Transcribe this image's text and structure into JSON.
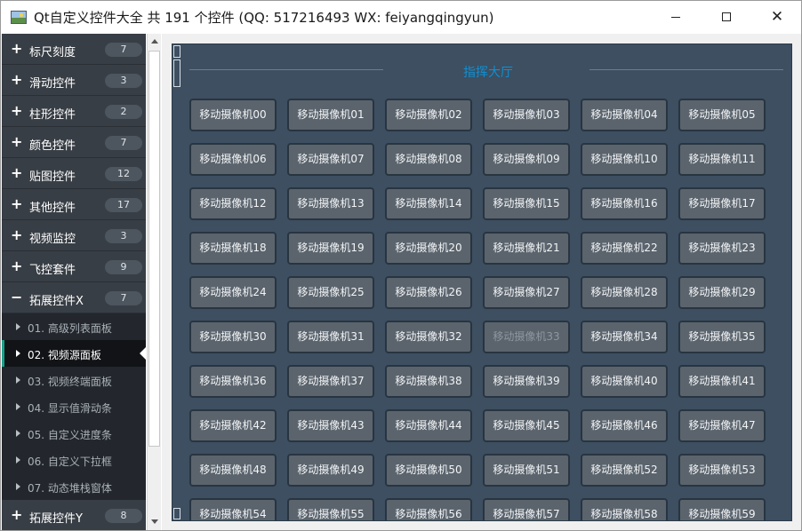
{
  "window": {
    "title": "Qt自定义控件大全 共 191 个控件 (QQ: 517216493 WX: feiyangqingyun)",
    "icon": "app-picture-icon",
    "controls": {
      "minimize": "─",
      "maximize": "☐",
      "close": "✕"
    }
  },
  "sidebar": {
    "parents": [
      {
        "name": "ruler",
        "label": "标尺刻度",
        "count": "7",
        "expanded": false
      },
      {
        "name": "slider",
        "label": "滑动控件",
        "count": "3",
        "expanded": false
      },
      {
        "name": "bar",
        "label": "柱形控件",
        "count": "2",
        "expanded": false
      },
      {
        "name": "color",
        "label": "颜色控件",
        "count": "7",
        "expanded": false
      },
      {
        "name": "image",
        "label": "贴图控件",
        "count": "12",
        "expanded": false
      },
      {
        "name": "other",
        "label": "其他控件",
        "count": "17",
        "expanded": false
      },
      {
        "name": "video",
        "label": "视频监控",
        "count": "3",
        "expanded": false
      },
      {
        "name": "flight",
        "label": "飞控套件",
        "count": "9",
        "expanded": false
      },
      {
        "name": "extx",
        "label": "拓展控件X",
        "count": "7",
        "expanded": true
      },
      {
        "name": "exty",
        "label": "拓展控件Y",
        "count": "8",
        "expanded": false
      }
    ],
    "children": [
      {
        "label": "01. 高级列表面板",
        "active": false
      },
      {
        "label": "02. 视频源面板",
        "active": true
      },
      {
        "label": "03. 视频终端面板",
        "active": false
      },
      {
        "label": "04. 显示值滑动条",
        "active": false
      },
      {
        "label": "05. 自定义进度条",
        "active": false
      },
      {
        "label": "06. 自定义下拉框",
        "active": false
      },
      {
        "label": "07. 动态堆栈窗体",
        "active": false
      }
    ],
    "expand_symbol": "+",
    "collapse_symbol": "−"
  },
  "panel": {
    "group_title": "指挥大厅",
    "disabled_index": 33,
    "cameras": [
      "移动摄像机00",
      "移动摄像机01",
      "移动摄像机02",
      "移动摄像机03",
      "移动摄像机04",
      "移动摄像机05",
      "移动摄像机06",
      "移动摄像机07",
      "移动摄像机08",
      "移动摄像机09",
      "移动摄像机10",
      "移动摄像机11",
      "移动摄像机12",
      "移动摄像机13",
      "移动摄像机14",
      "移动摄像机15",
      "移动摄像机16",
      "移动摄像机17",
      "移动摄像机18",
      "移动摄像机19",
      "移动摄像机20",
      "移动摄像机21",
      "移动摄像机22",
      "移动摄像机23",
      "移动摄像机24",
      "移动摄像机25",
      "移动摄像机26",
      "移动摄像机27",
      "移动摄像机28",
      "移动摄像机29",
      "移动摄像机30",
      "移动摄像机31",
      "移动摄像机32",
      "移动摄像机33",
      "移动摄像机34",
      "移动摄像机35",
      "移动摄像机36",
      "移动摄像机37",
      "移动摄像机38",
      "移动摄像机39",
      "移动摄像机40",
      "移动摄像机41",
      "移动摄像机42",
      "移动摄像机43",
      "移动摄像机44",
      "移动摄像机45",
      "移动摄像机46",
      "移动摄像机47",
      "移动摄像机48",
      "移动摄像机49",
      "移动摄像机50",
      "移动摄像机51",
      "移动摄像机52",
      "移动摄像机53",
      "移动摄像机54",
      "移动摄像机55",
      "移动摄像机56",
      "移动摄像机57",
      "移动摄像机58",
      "移动摄像机59"
    ]
  },
  "colors": {
    "sidebar_bg": "#262b31",
    "parent_bg": "#383e45",
    "active_accent": "#1aa28a",
    "panel_bg": "#3d4f61",
    "group_title": "#0f8fd2",
    "camera_button": "#5b646d"
  }
}
